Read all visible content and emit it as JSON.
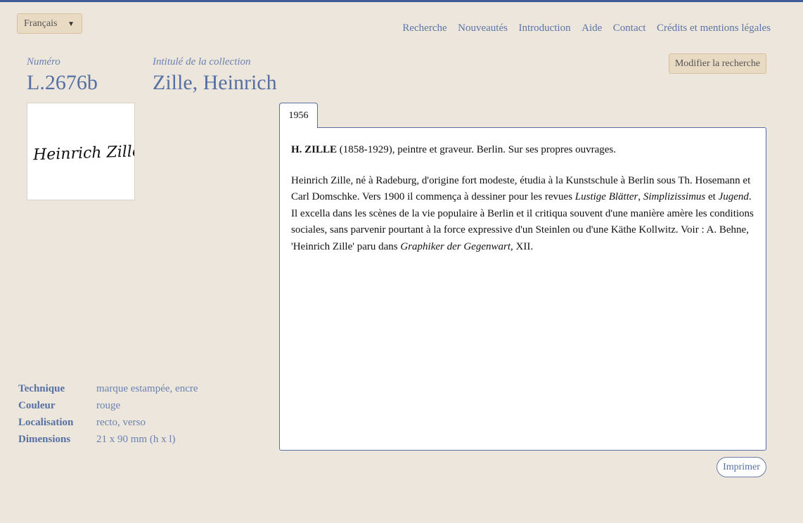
{
  "language_select": {
    "value": "Français",
    "caret_icon": "caret-down-icon"
  },
  "nav": {
    "items": [
      {
        "label": "Recherche"
      },
      {
        "label": "Nouveautés"
      },
      {
        "label": "Introduction"
      },
      {
        "label": "Aide"
      },
      {
        "label": "Contact"
      },
      {
        "label": "Crédits et mentions légales"
      }
    ]
  },
  "record": {
    "number_label": "Numéro",
    "number": "L.2676b",
    "collection_label": "Intitulé de la collection",
    "collection": "Zille, Heinrich",
    "signature_text": "Heinrich Zille.",
    "modify_button": "Modifier la recherche"
  },
  "tab": {
    "label": "1956"
  },
  "content": {
    "p1_bold": "H. ZILLE",
    "p1_rest": " (1858-1929), peintre et graveur. Berlin. Sur ses propres ouvrages.",
    "p2_a": "Heinrich Zille, né à Radeburg, d'origine fort modeste, étudia à la Kunstschule à Berlin sous Th. Hosemann et Carl Domschke. Vers 1900 il commença à dessiner pour les revues ",
    "p2_i1": "Lustige Blätter",
    "p2_b": ", ",
    "p2_i2": "Simplizissimus",
    "p2_c": " et ",
    "p2_i3": "Jugend",
    "p2_d": ". Il excella dans les scènes de la vie populaire à Berlin et il critiqua souvent d'une manière amère les conditions sociales, sans parvenir pourtant à la force expressive d'un Steinlen ou d'une Käthe Kollwitz. Voir : A. Behne, 'Heinrich Zille' paru dans ",
    "p2_i4": "Graphiker der Gegenwart",
    "p2_e": ", XII."
  },
  "details": [
    {
      "key": "Technique",
      "value": "marque estampée, encre"
    },
    {
      "key": "Couleur",
      "value": "rouge"
    },
    {
      "key": "Localisation",
      "value": "recto, verso"
    },
    {
      "key": "Dimensions",
      "value": "21 x 90 mm (h x l)"
    }
  ],
  "print_button": "Imprimer"
}
